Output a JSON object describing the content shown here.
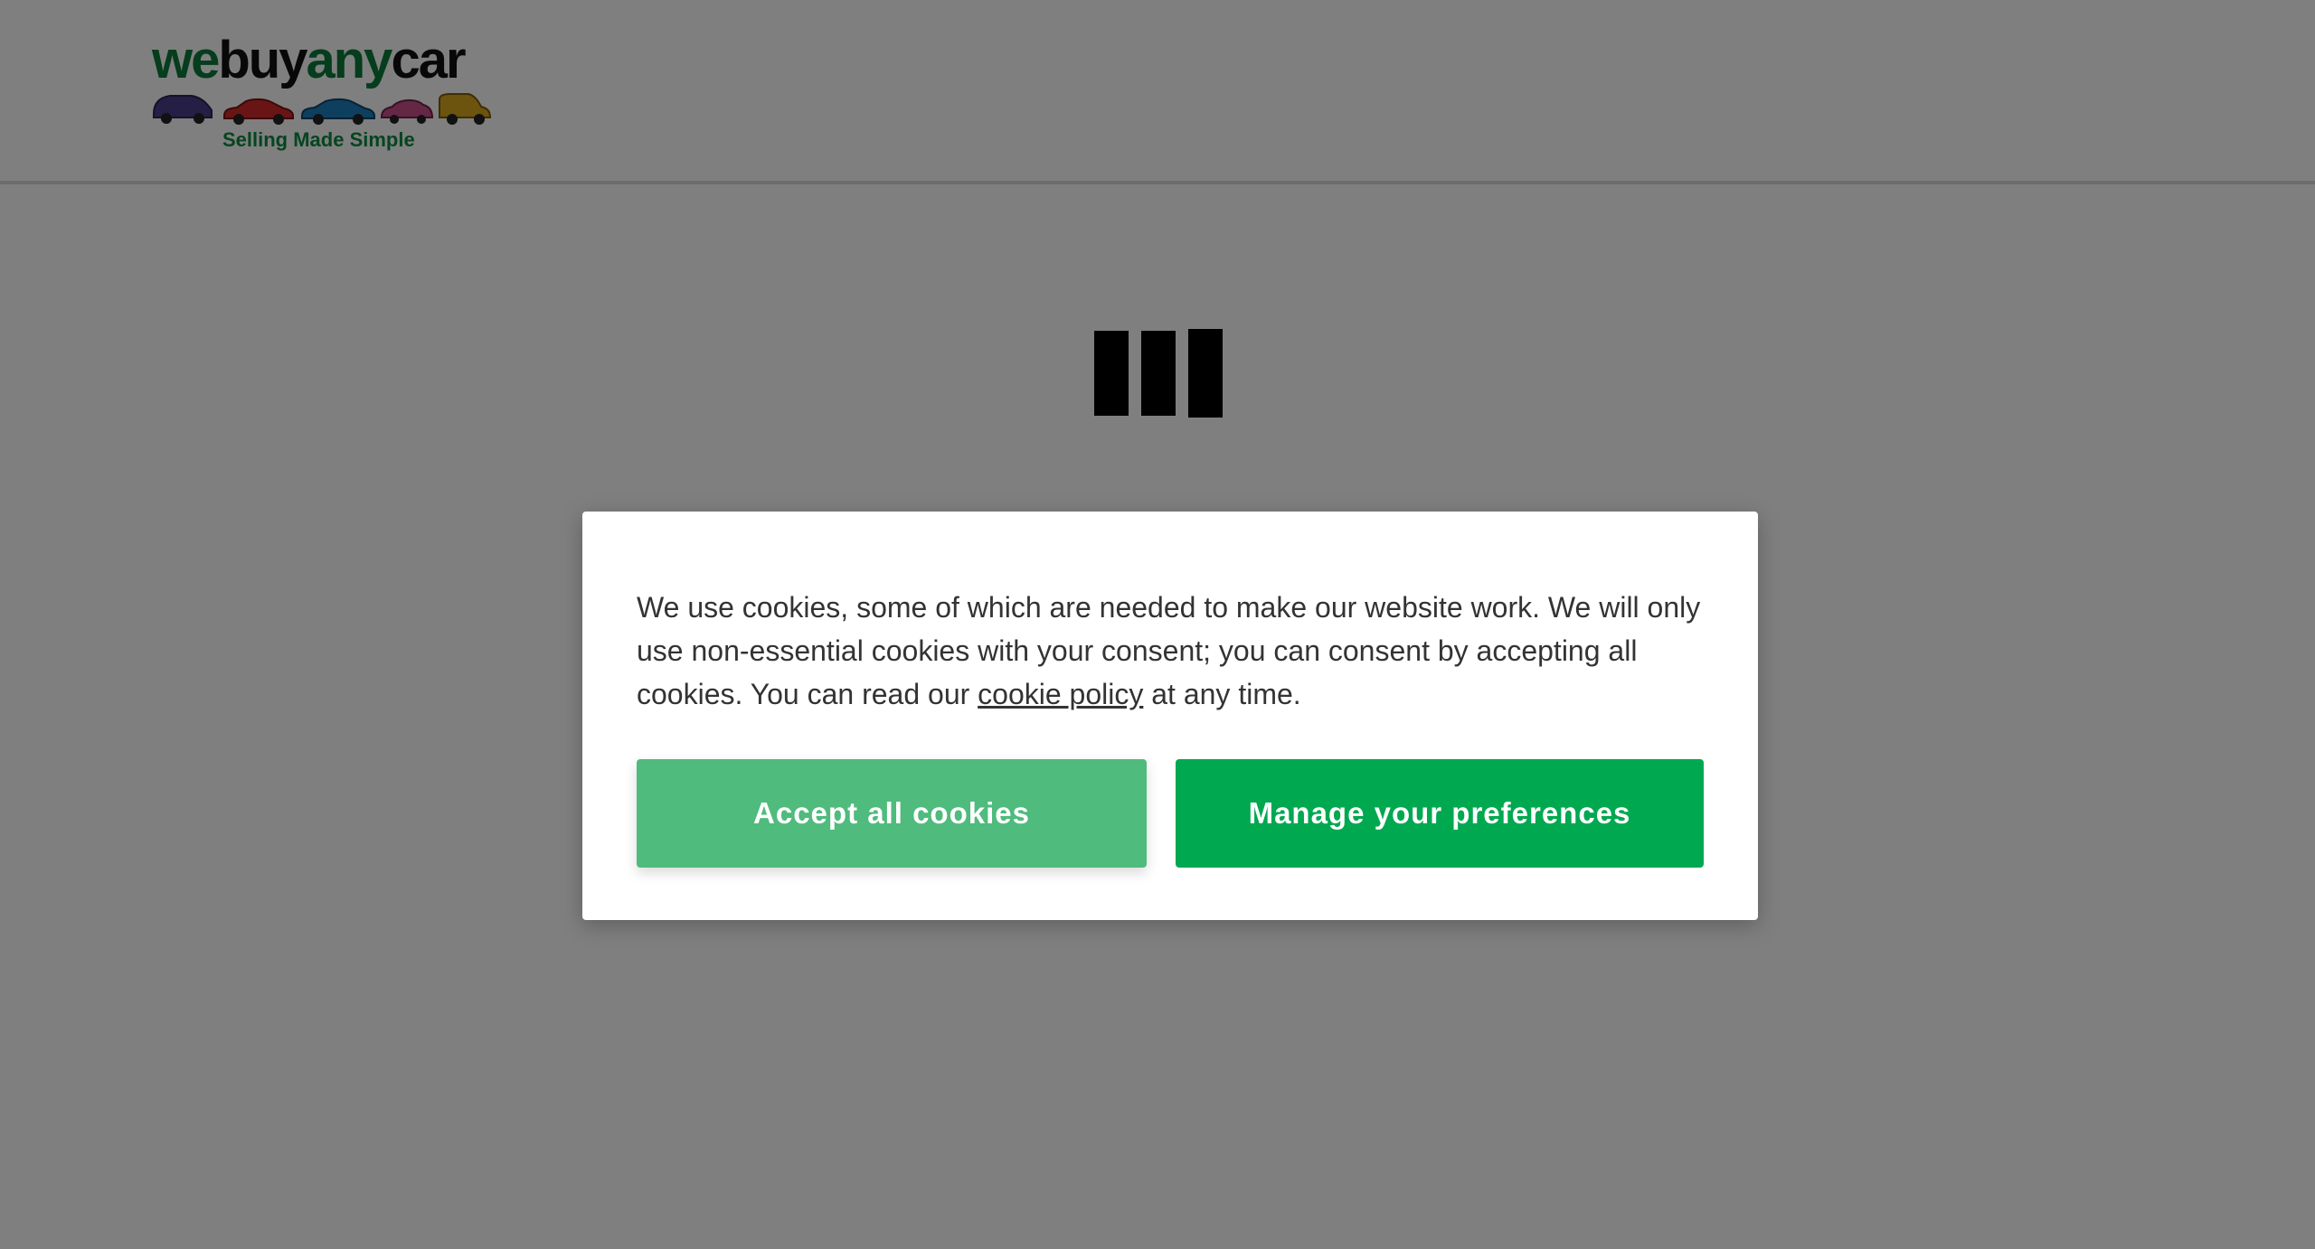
{
  "header": {
    "logo": {
      "word_we": "we",
      "word_buy": "buy",
      "word_any": "any",
      "word_car": "car",
      "tagline": "Selling Made Simple",
      "car_colors": [
        "#4a3f8c",
        "#d42a2a",
        "#1f7fbf",
        "#c9508a",
        "#d9a91f"
      ]
    }
  },
  "loader": {
    "icon": "loading-bars-icon"
  },
  "cookie_dialog": {
    "text_before_link": "We use cookies, some of which are needed to make our website work. We will only use non-essential cookies with your consent; you can consent by accepting all cookies. You can read our ",
    "link_label": "cookie policy",
    "text_after_link": " at any time.",
    "accept_label": "Accept all cookies",
    "manage_label": "Manage your preferences"
  },
  "colors": {
    "brand_green": "#0b7a3a",
    "accept_button": "#4fbb7d",
    "manage_button": "#00a850",
    "overlay": "rgba(0,0,0,0.5)"
  }
}
